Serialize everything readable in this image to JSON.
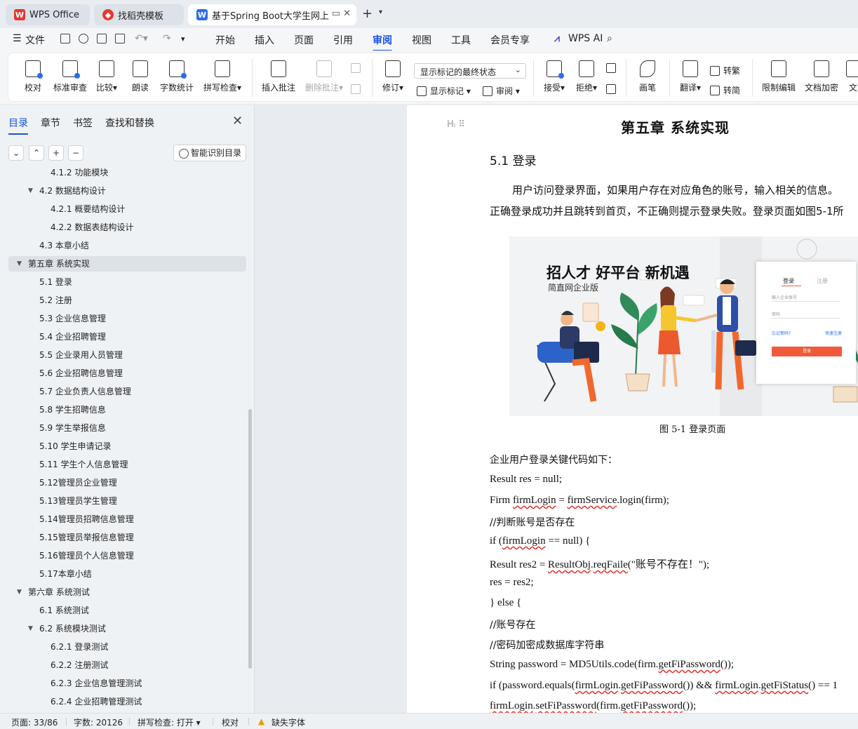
{
  "tabs": [
    {
      "label": "WPS Office",
      "logo": "wps-logo",
      "color": "#e6372f"
    },
    {
      "label": "找稻壳模板",
      "logo": "docer-logo",
      "color": "#e6372f"
    },
    {
      "label": "基于Spring Boot大学生网上",
      "logo": "wps-writer-logo",
      "color": "#2a6cf0"
    }
  ],
  "menu": {
    "file": "文件",
    "items": [
      "开始",
      "插入",
      "页面",
      "引用",
      "审阅",
      "视图",
      "工具",
      "会员专享"
    ],
    "active": "审阅",
    "ai": "WPS AI"
  },
  "ribbon": {
    "proofread": "校对",
    "standard_review": "标准审查",
    "compare": "比较",
    "read_aloud": "朗读",
    "word_count": "字数统计",
    "spell_check": "拼写检查",
    "insert_comment": "插入批注",
    "delete_comment": "删除批注",
    "revise": "修订",
    "markup_select": "显示标记的最终状态",
    "show_markup": "显示标记",
    "review": "审阅",
    "accept": "接受",
    "reject": "拒绝",
    "pen": "画笔",
    "translate": "翻译",
    "to_traditional": "转繁",
    "to_simplified": "转简",
    "restrict_edit": "限制编辑",
    "doc_encrypt": "文档加密",
    "doc_more": "文"
  },
  "panel": {
    "tabs": [
      "目录",
      "章节",
      "书签",
      "查找和替换"
    ],
    "smart_toc": "智能识别目录",
    "toc": [
      {
        "label": "4.1.2  功能模块",
        "level": 3
      },
      {
        "label": "4.2  数据结构设计",
        "level": 2,
        "expand": true
      },
      {
        "label": "4.2.1  概要结构设计",
        "level": 3
      },
      {
        "label": "4.2.2  数据表结构设计",
        "level": 3
      },
      {
        "label": "4.3  本章小结",
        "level": 2
      },
      {
        "label": "第五章    系统实现",
        "level": 1,
        "expand": true,
        "selected": true
      },
      {
        "label": "5.1  登录",
        "level": 2
      },
      {
        "label": "5.2  注册",
        "level": 2
      },
      {
        "label": "5.3  企业信息管理",
        "level": 2
      },
      {
        "label": "5.4  企业招聘管理",
        "level": 2
      },
      {
        "label": "5.5  企业录用人员管理",
        "level": 2
      },
      {
        "label": "5.6  企业招聘信息管理",
        "level": 2
      },
      {
        "label": "5.7  企业负责人信息管理",
        "level": 2
      },
      {
        "label": "5.8  学生招聘信息",
        "level": 2
      },
      {
        "label": "5.9  学生举报信息",
        "level": 2
      },
      {
        "label": "5.10  学生申请记录",
        "level": 2
      },
      {
        "label": "5.11  学生个人信息管理",
        "level": 2
      },
      {
        "label": "5.12管理员企业管理",
        "level": 2
      },
      {
        "label": "5.13管理员学生管理",
        "level": 2
      },
      {
        "label": "5.14管理员招聘信息管理",
        "level": 2
      },
      {
        "label": "5.15管理员举报信息管理",
        "level": 2
      },
      {
        "label": "5.16管理员个人信息管理",
        "level": 2
      },
      {
        "label": "5.17本章小结",
        "level": 2
      },
      {
        "label": "第六章  系统测试",
        "level": 1,
        "expand": true
      },
      {
        "label": "6.1 系统测试",
        "level": 2
      },
      {
        "label": "6.2 系统模块测试",
        "level": 2,
        "expand": true
      },
      {
        "label": "6.2.1 登录测试",
        "level": 3
      },
      {
        "label": "6.2.2 注册测试",
        "level": 3
      },
      {
        "label": "6.2.3 企业信息管理测试",
        "level": 3
      },
      {
        "label": "6.2.4 企业招聘管理测试",
        "level": 3
      }
    ]
  },
  "doc": {
    "heading_marker": "H",
    "chapter": "第五章    系统实现",
    "section": "5.1  登录",
    "para1": "用户访问登录界面，如果用户存在对应角色的账号，输入相关的信息。",
    "para2": "正确登录成功并且跳转到首页，不正确则提示登录失败。登录页面如图5-1所",
    "figure": {
      "title": "招人才 好平台 新机遇",
      "subtitle": "简直网企业版",
      "login_tab": "登录",
      "register_tab": "注册",
      "field_account": "输入企业账号",
      "field_password": "密码",
      "forgot": "忘记密码?",
      "register_link": "快速注册",
      "submit": "登录"
    },
    "caption": "图 5-1 登录页面",
    "code_intro": "企业用户登录关键代码如下：",
    "code": {
      "l1": "Result res = null;",
      "l2a": "Firm ",
      "l2b": "firmLogin",
      "l2c": " = ",
      "l2d": "firmService",
      "l2e": ".login(firm);",
      "l3": "//判断账号是否存在",
      "l4a": "if (",
      "l4b": "firmLogin",
      "l4c": " == null) {",
      "l5a": "Result res2 = ",
      "l5b": "ResultObj",
      "l5c": ".",
      "l5d": "reqFaile",
      "l5e": "(\"账号不存在！\");",
      "l6": "res = res2;",
      "l7": "} else {",
      "l8": "//账号存在",
      "l9": "//密码加密成数据库字符串",
      "l10a": "String password = MD5Utils.code(firm.",
      "l10b": "getFiPassword",
      "l10c": "());",
      "l11a": "if (password.equals(",
      "l11b": "firmLogin",
      "l11c": ".",
      "l11d": "getFiPassword",
      "l11e": "()) && ",
      "l11f": "firmLogin",
      "l11g": ".",
      "l11h": "getFiStatus",
      "l11i": "() == 1",
      "l12a": "firmLogin",
      "l12b": ".",
      "l12c": "setFiPassword",
      "l12d": "(firm.",
      "l12e": "getFiPassword",
      "l12f": "());"
    }
  },
  "status": {
    "page": "页面: 33/86",
    "words": "字数: 20126",
    "spell": "拼写检查: 打开",
    "proof": "校对",
    "missing_font": "缺失字体"
  },
  "colors": {
    "accent": "#1a53e0",
    "wps_red": "#e6372f",
    "squiggle": "#e0302a"
  }
}
